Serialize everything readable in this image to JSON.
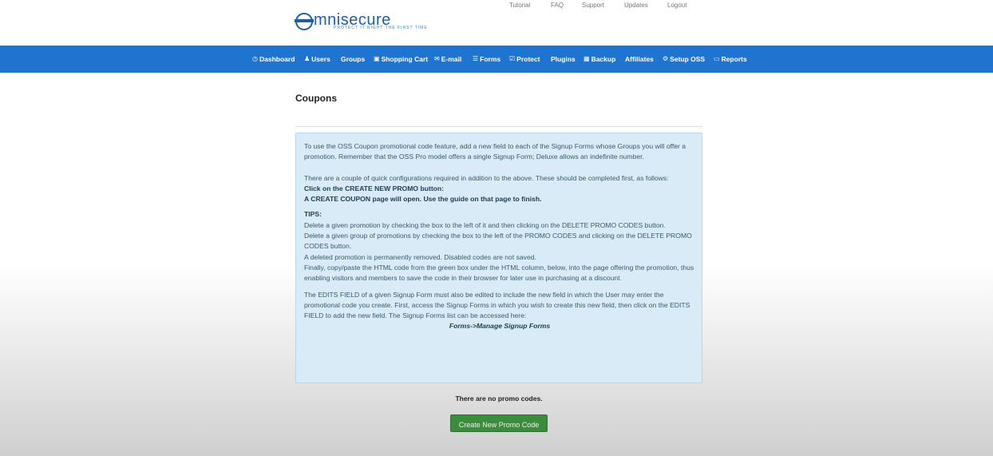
{
  "logo": {
    "text": "mnisecure",
    "tagline": "PROTECT IT RIGHT THE FIRST TIME"
  },
  "top_links": [
    "Tutorial",
    "FAQ",
    "Support",
    "Updates",
    "Logout"
  ],
  "nav": [
    {
      "label": "Dashboard",
      "icon": "dashboard-icon",
      "glyph": "◷"
    },
    {
      "label": "Users",
      "icon": "user-icon",
      "glyph": "👤"
    },
    {
      "label": "Groups",
      "icon": "",
      "glyph": ""
    },
    {
      "label": "Shopping Cart",
      "icon": "cart-icon",
      "glyph": "🛒"
    },
    {
      "label": "E-mail",
      "icon": "envelope-icon",
      "glyph": "✉"
    },
    {
      "label": "Forms",
      "icon": "list-icon",
      "glyph": "☰"
    },
    {
      "label": "Protect",
      "icon": "check-icon",
      "glyph": "☑"
    },
    {
      "label": "Plugins",
      "icon": "",
      "glyph": ""
    },
    {
      "label": "Backup",
      "icon": "disk-icon",
      "glyph": "▦"
    },
    {
      "label": "Affiliates",
      "icon": "",
      "glyph": ""
    },
    {
      "label": "Setup OSS",
      "icon": "gear-icon",
      "glyph": "⚙"
    },
    {
      "label": "Reports",
      "icon": "inbox-icon",
      "glyph": "▭"
    }
  ],
  "page": {
    "title": "Coupons"
  },
  "info": {
    "p1": "To use the OSS Coupon promotional code feature, add a new field to each of the Signup Forms whose Groups you will offer a promotion. Remember that the OSS Pro model offers a single Signup Form; Deluxe allows an indefinite number.",
    "p2": "There are a couple of quick configurations required in addition to the above. These should be completed first, as follows:",
    "step1": "Click on the CREATE NEW PROMO button:",
    "step2": "A CREATE COUPON page will open. Use the guide on that page to finish.",
    "tips_heading": "TIPS:",
    "tip1": "Delete a given promotion by checking the box to the left of it and then clicking on the DELETE PROMO CODES button.",
    "tip2": "Delete a given group of promotions by checking the box to the left of the PROMO CODES and clicking on the DELETE PROMO CODES button.",
    "tip3": "A deleted promotion is permanently removed. Disabled codes are not saved.",
    "tip4": "Finally, copy/paste the HTML code from the green box under the HTML column, below, into the page offering the promotion, thus enabling visitors and members to save the code in their browser for later use in purchasing at a discount.",
    "p3": "The EDITS FIELD of a given Signup Form must also be edited to include the new field in which the User may enter the promotional code you create. First, access the Signup Forms in which you wish to create this new field, then click on the EDITS FIELD to add the new field. The Signup Forms list can be accessed here:",
    "link": "Forms->Manage Signup Forms"
  },
  "status": {
    "no_codes": "There are no promo codes."
  },
  "buttons": {
    "create": "Create New Promo Code"
  },
  "colors": {
    "nav_bg": "#1f74d0",
    "info_bg": "#d8ebf6",
    "button_bg": "#3d8c3e",
    "logo": "#1e5fa3"
  }
}
